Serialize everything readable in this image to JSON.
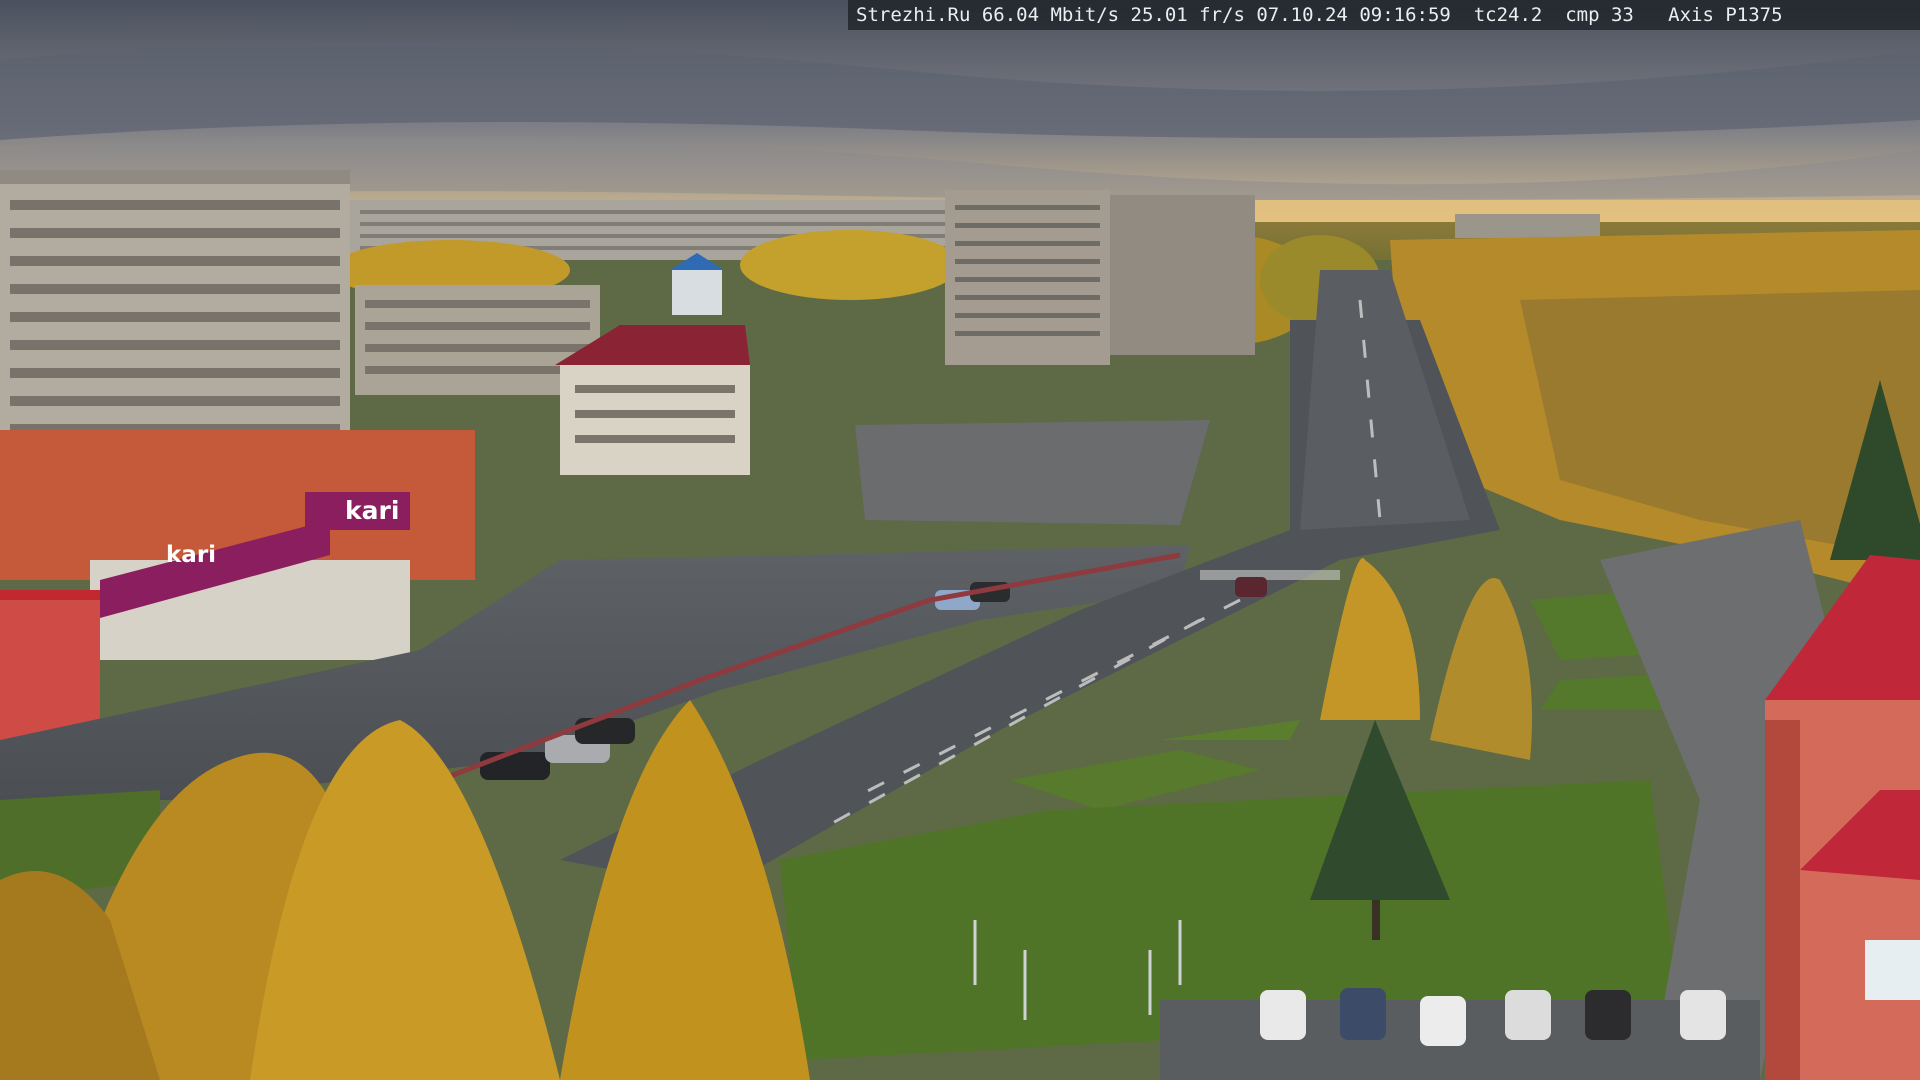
{
  "overlay": {
    "text": "Strezhi.Ru 66.04 Mbit/s 25.01 fr/s 07.10.24 09:16:59  tc24.2  cmp 33   Axis P1375"
  },
  "signs": {
    "store_top": "kari",
    "store_main": "kari"
  },
  "scene": {
    "colors": {
      "sky_top": "#4e5563",
      "sky_bottom": "#b9a58e",
      "horizon_glow": "#e8c483",
      "asphalt": "#54585c",
      "grass": "#5a7a2e",
      "autumn_tree": "#c99a22",
      "store_facade": "#c9553a",
      "kari_banner": "#8b1e5e",
      "roof_red": "#c0283a"
    }
  }
}
